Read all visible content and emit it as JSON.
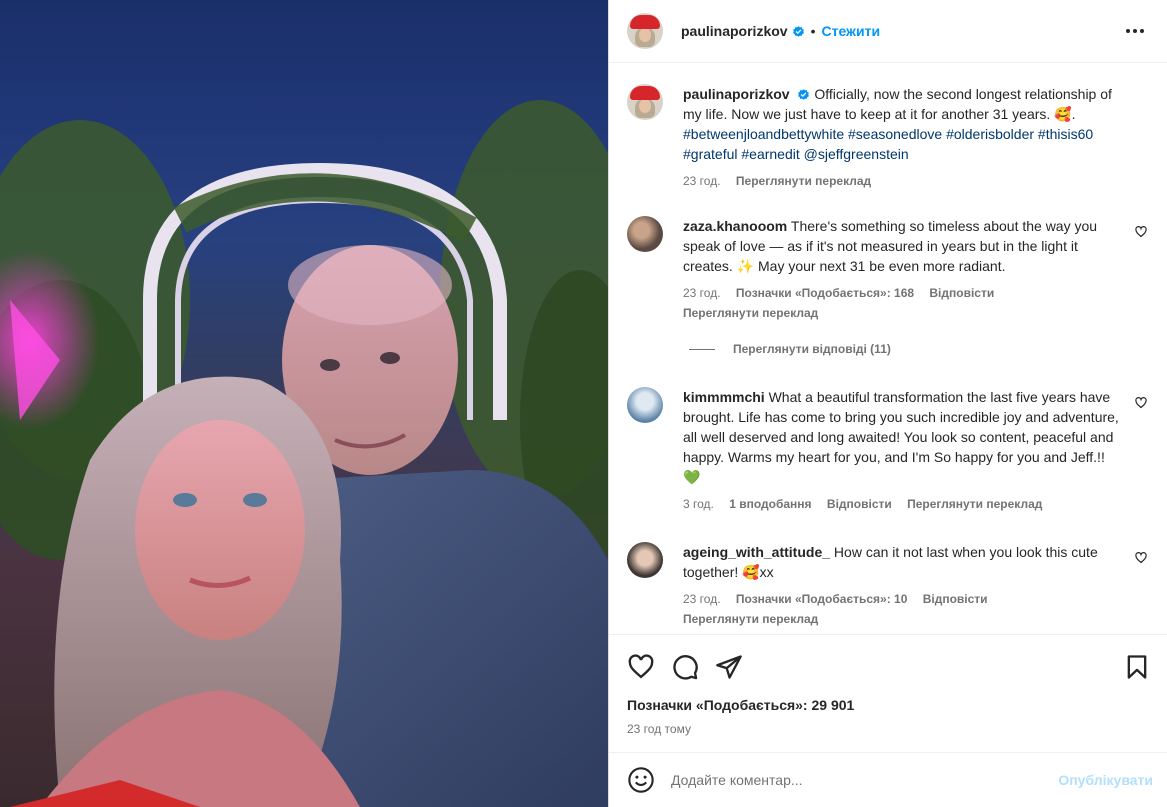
{
  "header": {
    "username": "paulinaporizkov",
    "separator": "•",
    "follow_label": "Стежити",
    "more_icon": "more-horizontal-icon"
  },
  "caption": {
    "username": "paulinaporizkov",
    "text": "Officially, now the second longest relationship of my life. Now we just have to keep at it for another 31 years. 🥰.",
    "hashtags": "#betweenjloandbettywhite #seasonedlove #olderisbolder #thisis60 #grateful #earnedit @sjeffgreenstein",
    "time": "23 год.",
    "translate": "Переглянути переклад"
  },
  "comments": [
    {
      "username": "zaza.khanooom",
      "text": "There's something so timeless about the way you speak of love — as if it's not measured in years but in the light it creates. ✨ May your next 31 be even more radiant.",
      "time": "23 год.",
      "likes": "Позначки «Подобається»: 168",
      "reply": "Відповісти",
      "translate": "Переглянути переклад"
    },
    {
      "username": "kimmmmchi",
      "text": "What a beautiful transformation the last five years have brought. Life has come to bring you such incredible joy and adventure, all well deserved and long awaited! You look so content, peaceful and happy. Warms my heart for you, and I'm So happy for you and Jeff.!! 💚",
      "time": "3 год.",
      "likes": "1 вподобання",
      "reply": "Відповісти",
      "translate": "Переглянути переклад"
    },
    {
      "username": "ageing_with_attitude_",
      "text": "How can it not last when you look this cute together! 🥰xx",
      "time": "23 год.",
      "likes": "Позначки «Подобається»: 10",
      "reply": "Відповісти",
      "translate": "Переглянути переклад"
    }
  ],
  "view_replies": "Переглянути відповіді (11)",
  "actions": {
    "like_icon": "heart-icon",
    "comment_icon": "comment-icon",
    "share_icon": "share-icon",
    "save_icon": "bookmark-icon",
    "likes_total": "Позначки «Подобається»: 29 901",
    "posted": "23 год тому"
  },
  "composer": {
    "placeholder": "Додайте коментар...",
    "post_label": "Опублікувати",
    "emoji_icon": "emoji-icon"
  },
  "colors": {
    "accent": "#0095f6",
    "post_disabled": "#b2dffc",
    "muted": "#737373"
  }
}
